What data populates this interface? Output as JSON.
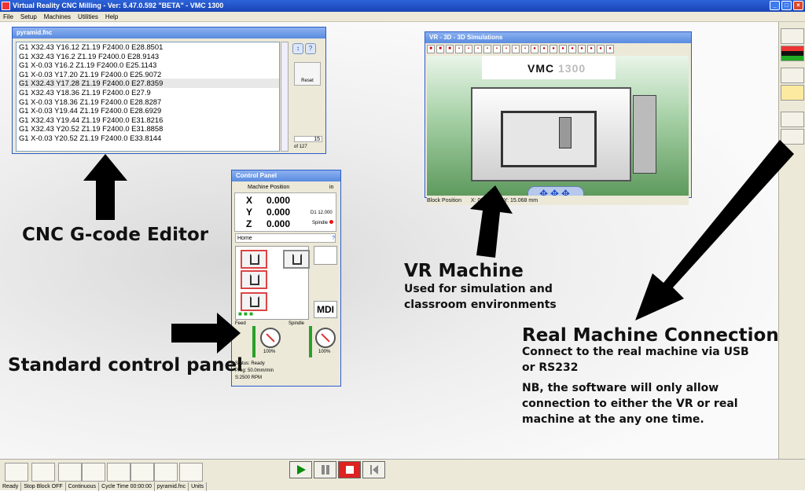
{
  "app": {
    "title": "Virtual Reality CNC Milling  -  Ver: 5.47.0.592 \"BETA\" - VMC 1300",
    "menu": [
      "File",
      "Setup",
      "Machines",
      "Utilities",
      "Help"
    ]
  },
  "gcode_editor": {
    "title": "pyramid.fnc",
    "lines": [
      "G1 X32.43 Y16.12 Z1.19 F2400.0 E28.8501",
      "G1 X32.43 Y16.2 Z1.19 F2400.0 E28.9143",
      "G1 X-0.03 Y16.2 Z1.19 F2400.0 E25.1143",
      "G1 X-0.03 Y17.20 Z1.19 F2400.0 E25.9072",
      "G1 X32.43 Y17.28 Z1.19 F2400.0 E27.8359",
      "G1 X32.43 Y18.36 Z1.19 F2400.0 E27.9",
      "G1 X-0.03 Y18.36 Z1.19 F2400.0 E28.8287",
      "G1 X-0.03 Y19.44 Z1.19 F2400.0 E28.6929",
      "G1 X32.43 Y19.44 Z1.19 F2400.0 E31.8216",
      "G1 X32.43 Y20.52 Z1.19 F2400.0 E31.8858",
      "G1 X-0.03 Y20.52 Z1.19 F2400.0 E33.8144"
    ],
    "line_counter_top": "15",
    "line_counter_bottom": "of 127",
    "side_button": "Reset"
  },
  "vr_window": {
    "title": "VR - 3D - 3D Simulations",
    "machine_label_main": "VMC",
    "machine_label_num": "1300",
    "status_left": "Block Position",
    "status_x": "X: 03.809",
    "status_y": "Y: 15.068 mm"
  },
  "control_panel": {
    "title": "Control Panel",
    "header": "Machine Position",
    "axes": [
      {
        "name": "X",
        "value": "0.000"
      },
      {
        "name": "Y",
        "value": "0.000"
      },
      {
        "name": "Z",
        "value": "0.000"
      }
    ],
    "side_label": "in",
    "side_value": "D1 12.000",
    "spindle_label": "Spindle",
    "mode_label": "Home",
    "feed_label": "Feed",
    "spindle_section_label": "Spindle",
    "feed_percent": "100%",
    "spindle_percent": "100%",
    "mdi_label": "MDI",
    "status_1": "Status: Ready",
    "status_2": "Prog: 50.0mm/min",
    "status_3": "S:2500 RPM"
  },
  "captions": {
    "editor": "CNC G-code Editor",
    "control": "Standard control panel",
    "vr_title": "VR Machine",
    "vr_desc": "Used for simulation and classroom environments",
    "real_title": "Real Machine Connection",
    "real_desc": "Connect to the real machine via USB or RS232",
    "real_note": "NB, the software will only allow connection to either the VR or real machine at the any one time."
  },
  "statusbar": [
    "Ready",
    "Stop Block OFF",
    "Continuous",
    "Cycle Time 00:00:00",
    "pyramid.fnc",
    "Units"
  ]
}
